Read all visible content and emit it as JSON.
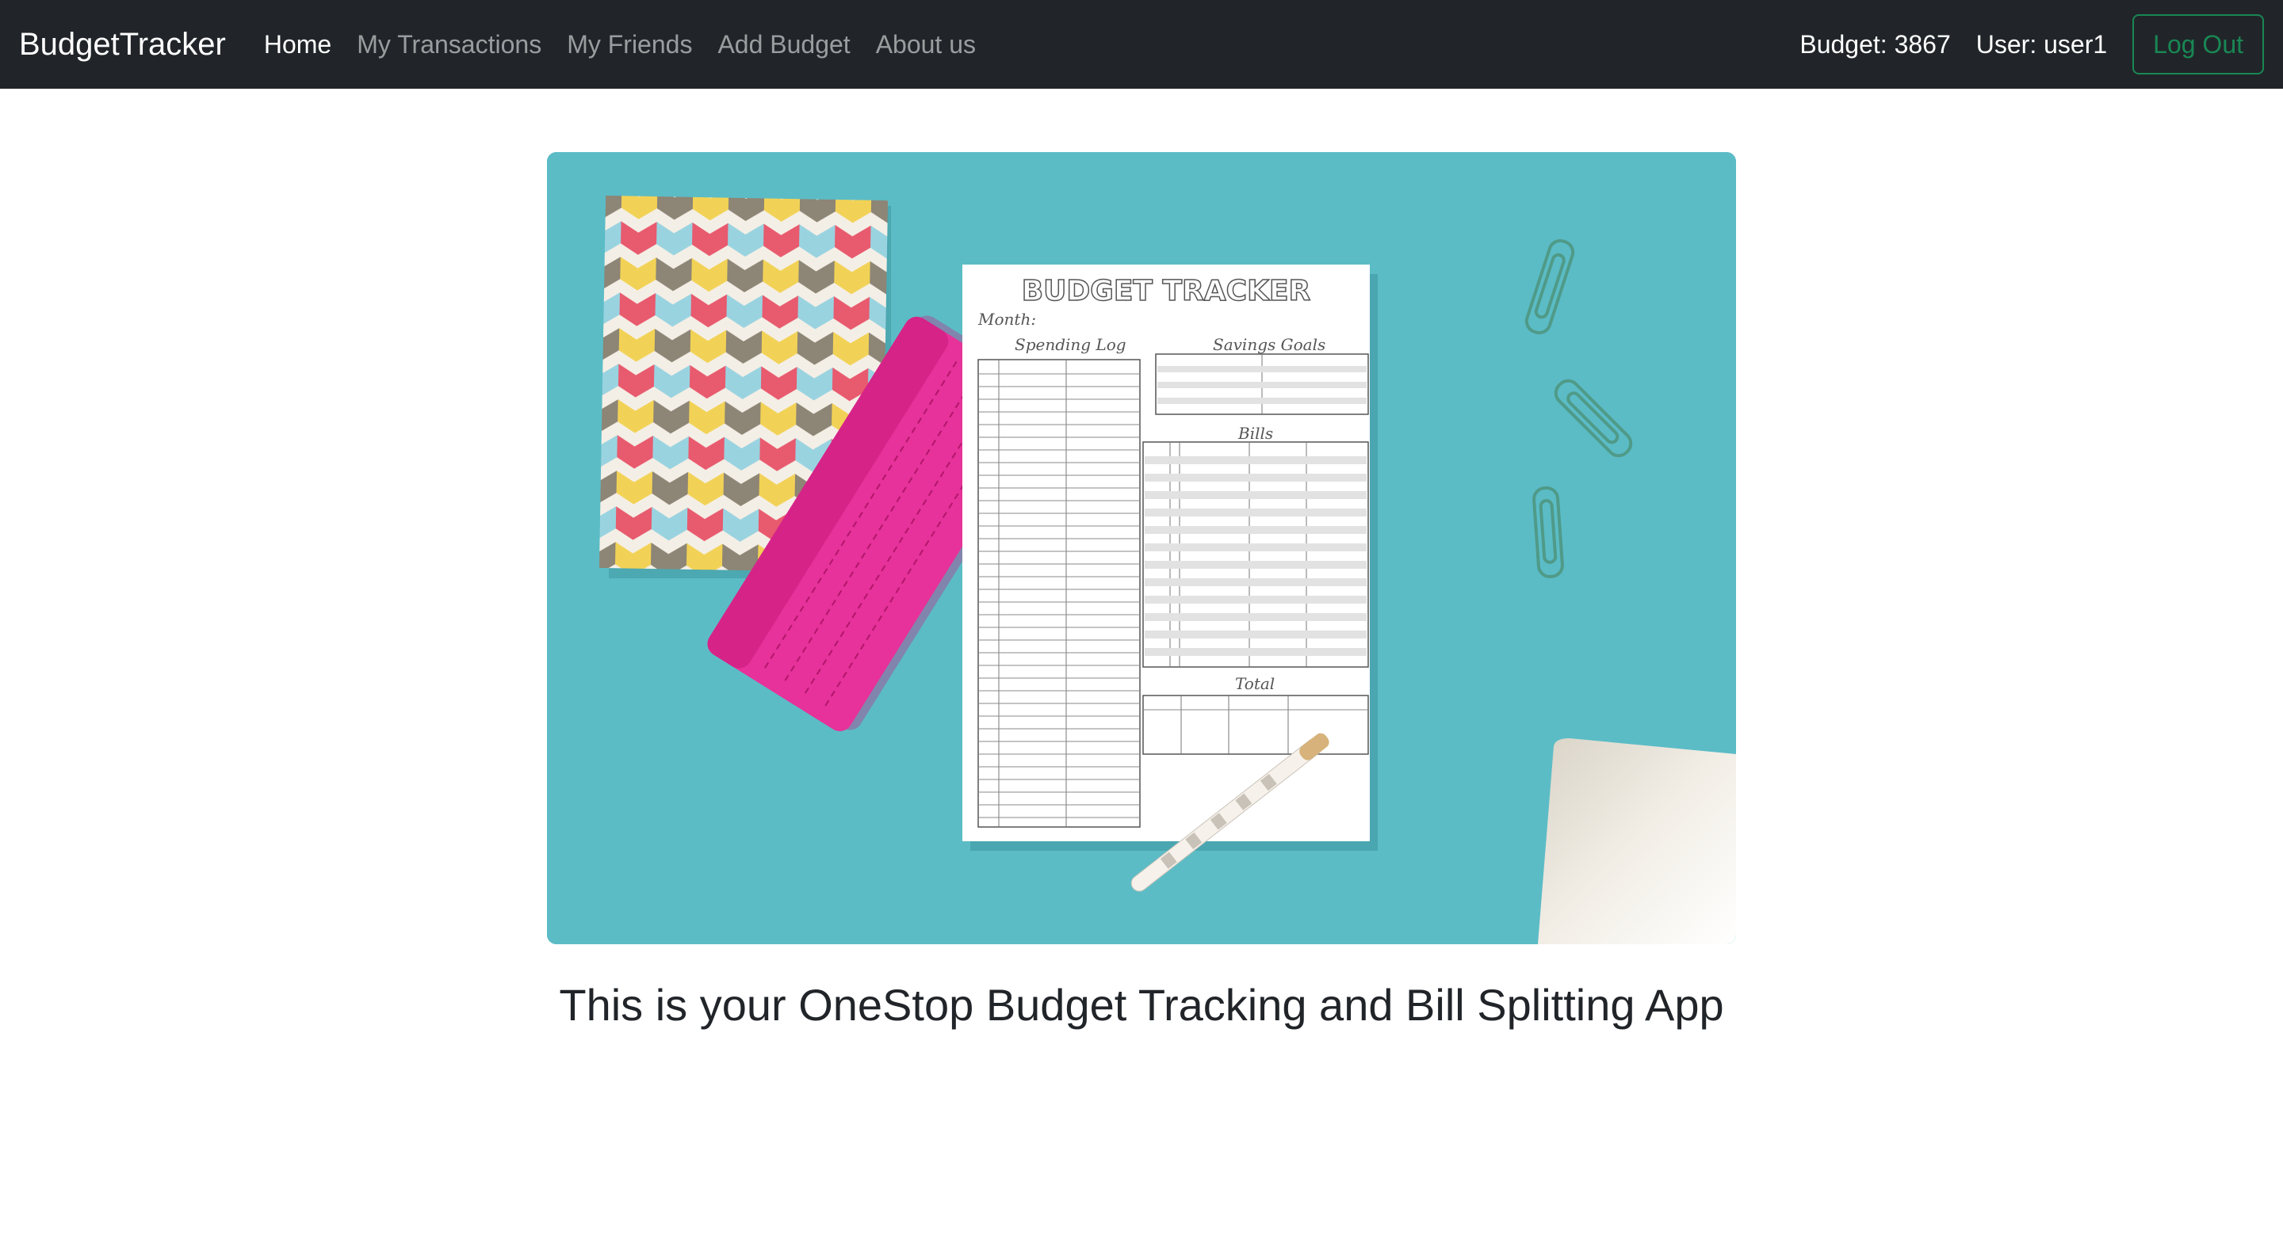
{
  "navbar": {
    "brand": "BudgetTracker",
    "links": [
      {
        "label": "Home",
        "active": true
      },
      {
        "label": "My Transactions",
        "active": false
      },
      {
        "label": "My Friends",
        "active": false
      },
      {
        "label": "Add Budget",
        "active": false
      },
      {
        "label": "About us",
        "active": false
      }
    ],
    "budget_text": "Budget: 3867",
    "user_text": "User: user1",
    "logout_label": "Log Out"
  },
  "hero": {
    "sheet_title": "BUDGET TRACKER",
    "sheet_month": "Month:",
    "sheet_spending": "Spending Log",
    "sheet_savings": "Savings Goals",
    "sheet_bills": "Bills",
    "sheet_total": "Total"
  },
  "main": {
    "tagline": "This is your OneStop Budget Tracking and Bill Splitting App"
  },
  "colors": {
    "navbar_bg": "#212529",
    "logout_accent": "#198754",
    "hero_bg": "#5bbcc6"
  }
}
